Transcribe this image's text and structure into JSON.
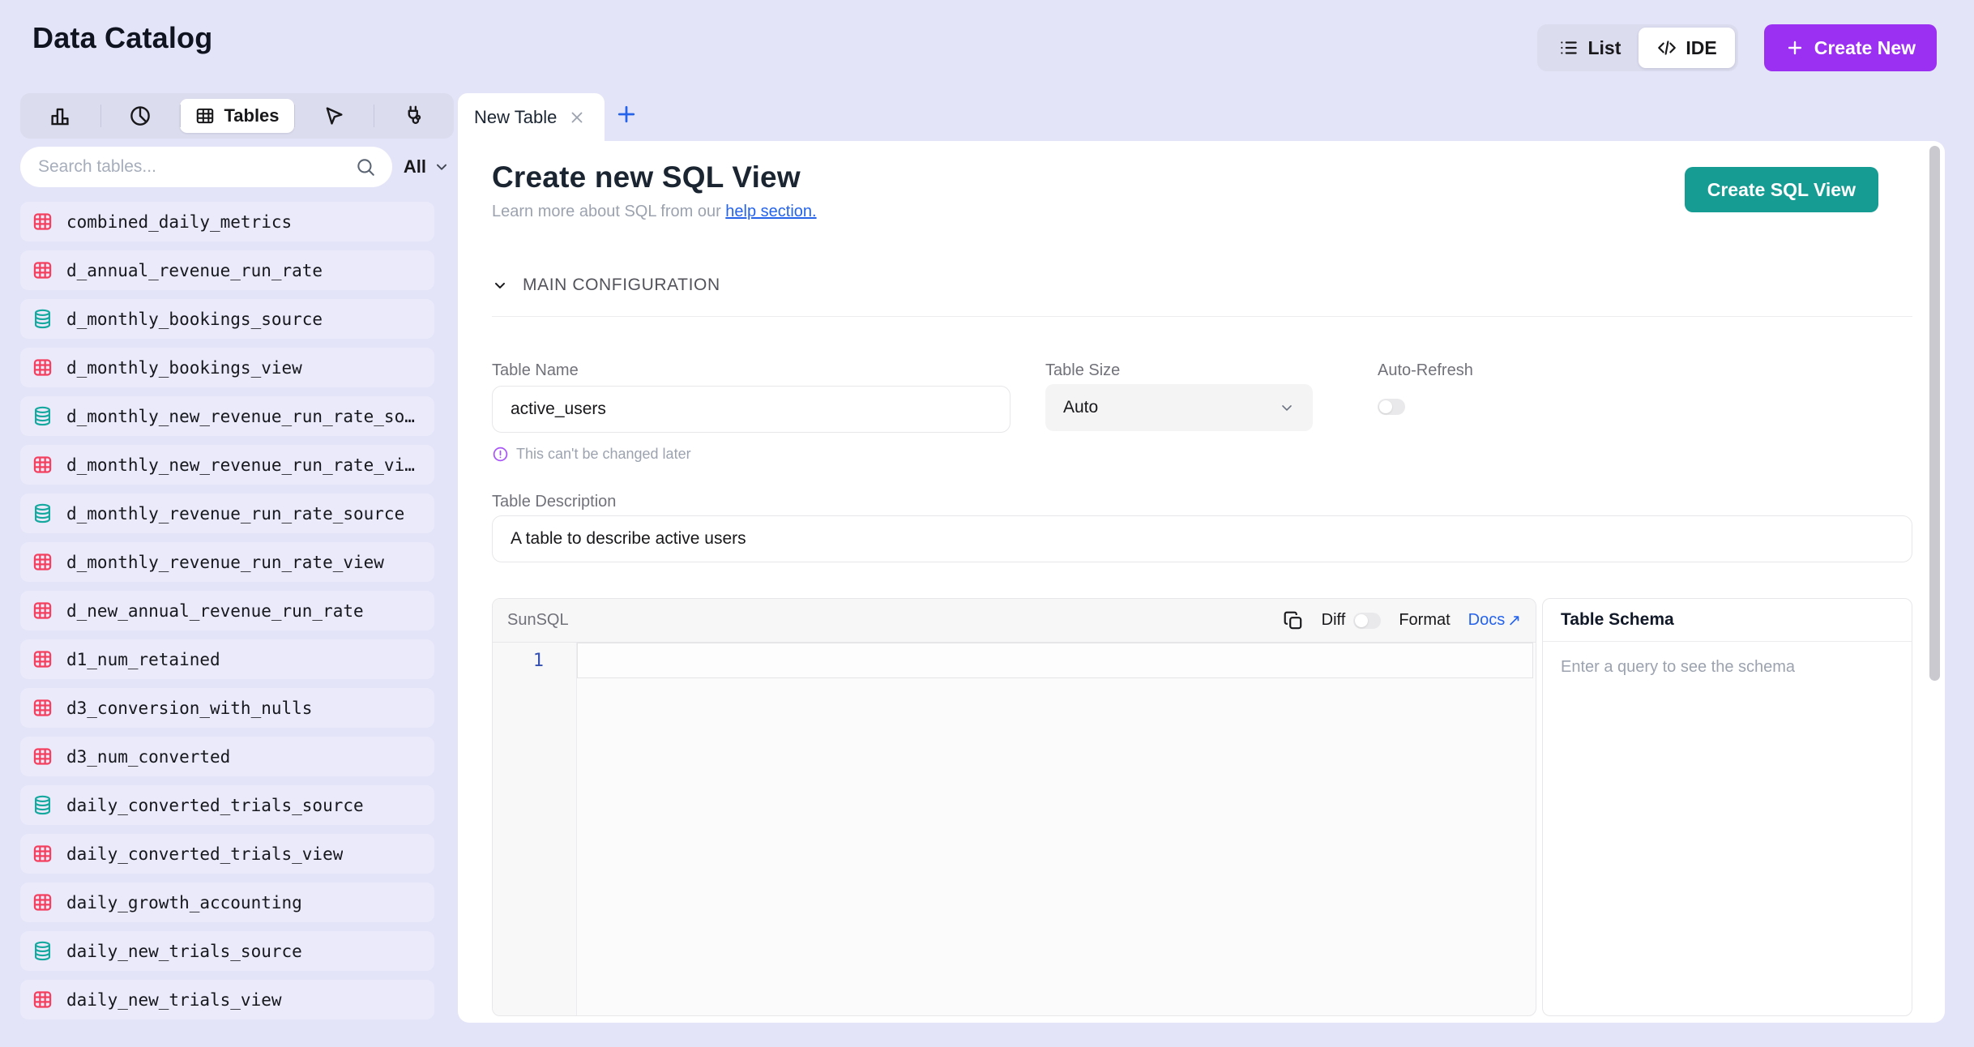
{
  "app": {
    "title": "Data Catalog"
  },
  "header": {
    "view_toggle": {
      "list_label": "List",
      "ide_label": "IDE",
      "active": "IDE"
    },
    "create_new_label": "Create New"
  },
  "sidebar": {
    "active_tab_label": "Tables",
    "search_placeholder": "Search tables...",
    "filter_label": "All",
    "items": [
      {
        "label": "combined_daily_metrics",
        "type": "view"
      },
      {
        "label": "d_annual_revenue_run_rate",
        "type": "view"
      },
      {
        "label": "d_monthly_bookings_source",
        "type": "source"
      },
      {
        "label": "d_monthly_bookings_view",
        "type": "view"
      },
      {
        "label": "d_monthly_new_revenue_run_rate_so…",
        "type": "source"
      },
      {
        "label": "d_monthly_new_revenue_run_rate_vi…",
        "type": "view"
      },
      {
        "label": "d_monthly_revenue_run_rate_source",
        "type": "source"
      },
      {
        "label": "d_monthly_revenue_run_rate_view",
        "type": "view"
      },
      {
        "label": "d_new_annual_revenue_run_rate",
        "type": "view"
      },
      {
        "label": "d1_num_retained",
        "type": "view"
      },
      {
        "label": "d3_conversion_with_nulls",
        "type": "view"
      },
      {
        "label": "d3_num_converted",
        "type": "view"
      },
      {
        "label": "daily_converted_trials_source",
        "type": "source"
      },
      {
        "label": "daily_converted_trials_view",
        "type": "view"
      },
      {
        "label": "daily_growth_accounting",
        "type": "view"
      },
      {
        "label": "daily_new_trials_source",
        "type": "source"
      },
      {
        "label": "daily_new_trials_view",
        "type": "view"
      }
    ]
  },
  "main": {
    "tab_label": "New Table",
    "heading": "Create new SQL View",
    "subtitle_prefix": "Learn more about SQL from our ",
    "subtitle_link": "help section.",
    "create_button": "Create SQL View",
    "section_title": "MAIN CONFIGURATION",
    "form": {
      "table_name": {
        "label": "Table Name",
        "value": "active_users",
        "note": "This can't be changed later"
      },
      "table_size": {
        "label": "Table Size",
        "value": "Auto"
      },
      "auto_refresh": {
        "label": "Auto-Refresh",
        "enabled": false
      },
      "description": {
        "label": "Table Description",
        "value": "A table to describe active users"
      }
    },
    "editor": {
      "language_label": "SunSQL",
      "diff_label": "Diff",
      "diff_enabled": false,
      "format_label": "Format",
      "docs_label": "Docs",
      "docs_arrow": "↗",
      "first_line_number": "1"
    },
    "schema": {
      "title": "Table Schema",
      "empty_text": "Enter a query to see the schema"
    }
  },
  "colors": {
    "page_background": "#E4E4F8",
    "accent_purple": "#9B2FF2",
    "accent_teal": "#169C93",
    "link_blue": "#2563EB",
    "view_icon_pink": "#F43F5E",
    "source_icon_teal": "#14A89E"
  }
}
